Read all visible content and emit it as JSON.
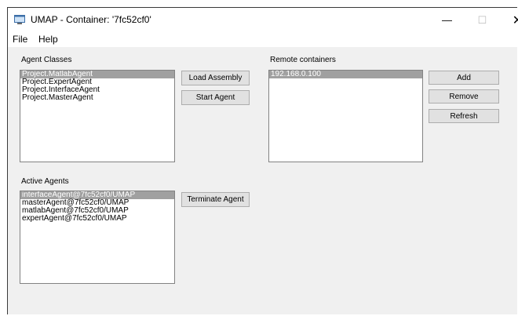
{
  "window": {
    "title": "UMAP - Container: '7fc52cf0'",
    "minimize": "—",
    "maximize": "☐",
    "close": "✕"
  },
  "menu": {
    "file": "File",
    "help": "Help"
  },
  "agent_classes": {
    "label": "Agent Classes",
    "items": [
      "Project.MatlabAgent",
      "Project.ExpertAgent",
      "Project.InterfaceAgent",
      "Project.MasterAgent"
    ],
    "selected_index": 0
  },
  "buttons": {
    "load_assembly": "Load Assembly",
    "start_agent": "Start Agent",
    "terminate_agent": "Terminate Agent",
    "add": "Add",
    "remove": "Remove",
    "refresh": "Refresh"
  },
  "remote_containers": {
    "label": "Remote containers",
    "items": [
      "192.168.0.100"
    ],
    "selected_index": 0
  },
  "active_agents": {
    "label": "Active Agents",
    "items": [
      "interfaceAgent@7fc52cf0/UMAP",
      "masterAgent@7fc52cf0/UMAP",
      "matlabAgent@7fc52cf0/UMAP",
      "expertAgent@7fc52cf0/UMAP"
    ],
    "selected_index": 0
  }
}
